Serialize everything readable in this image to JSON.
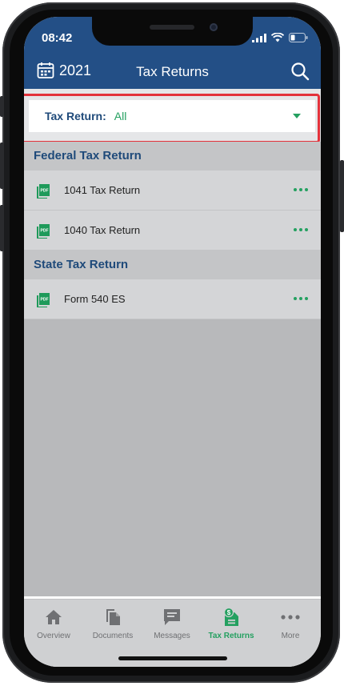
{
  "status": {
    "time": "08:42"
  },
  "header": {
    "year": "2021",
    "title": "Tax Returns",
    "year_icon": "calendar-icon",
    "search_icon": "search-icon"
  },
  "filter": {
    "label": "Tax Return:",
    "value": "All"
  },
  "sections": [
    {
      "title": "Federal Tax Return",
      "items": [
        {
          "name": "1041 Tax Return"
        },
        {
          "name": "1040 Tax Return"
        }
      ]
    },
    {
      "title": "State Tax Return",
      "items": [
        {
          "name": "Form 540 ES"
        }
      ]
    }
  ],
  "tabs": [
    {
      "label": "Overview",
      "icon": "home-icon"
    },
    {
      "label": "Documents",
      "icon": "documents-icon"
    },
    {
      "label": "Messages",
      "icon": "message-icon"
    },
    {
      "label": "Tax Returns",
      "icon": "tax-return-icon",
      "active": true
    },
    {
      "label": "More",
      "icon": "more-icon"
    }
  ],
  "colors": {
    "header": "#234f86",
    "accent": "#24a060",
    "highlight": "#e3323b"
  }
}
